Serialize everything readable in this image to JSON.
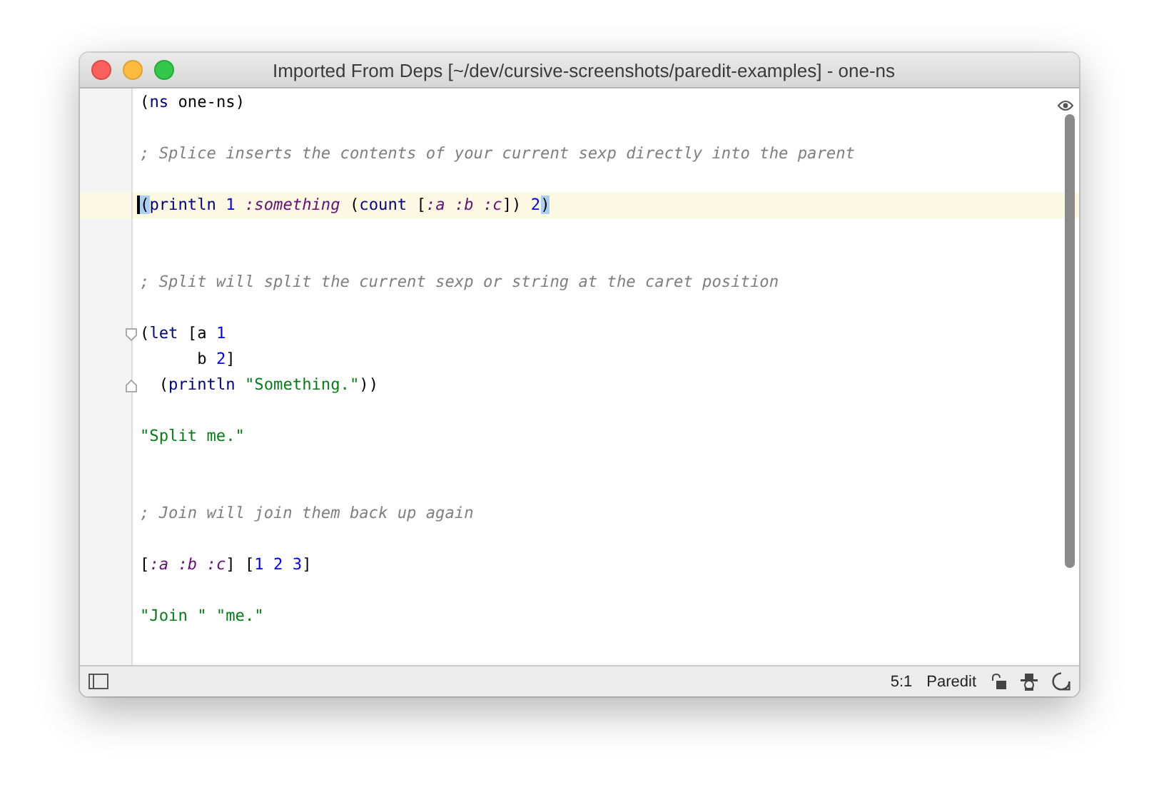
{
  "window": {
    "title": "Imported From Deps [~/dev/cursive-screenshots/paredit-examples] - one-ns"
  },
  "editor": {
    "lines": [
      {
        "kind": "code",
        "current": false,
        "tokens": [
          {
            "text": "(",
            "kind": "paren"
          },
          {
            "text": "ns",
            "kind": "form"
          },
          {
            "text": " one-ns",
            "kind": "symbol"
          },
          {
            "text": ")",
            "kind": "paren"
          }
        ]
      },
      {
        "kind": "blank"
      },
      {
        "kind": "code",
        "current": false,
        "tokens": [
          {
            "text": "; Splice inserts the contents of your current sexp directly into the parent",
            "kind": "comment"
          }
        ]
      },
      {
        "kind": "blank"
      },
      {
        "kind": "code",
        "current": true,
        "tokens": [
          {
            "text": "(",
            "kind": "paren",
            "matched": true
          },
          {
            "text": "println",
            "kind": "form"
          },
          {
            "text": " 1",
            "kind": "number"
          },
          {
            "text": " :something",
            "kind": "keyword"
          },
          {
            "text": " (",
            "kind": "paren"
          },
          {
            "text": "count",
            "kind": "form"
          },
          {
            "text": " [",
            "kind": "paren"
          },
          {
            "text": ":a :b :c",
            "kind": "keyword"
          },
          {
            "text": "]) ",
            "kind": "paren"
          },
          {
            "text": "2",
            "kind": "number"
          },
          {
            "text": ")",
            "kind": "paren",
            "matched": true
          }
        ]
      },
      {
        "kind": "blank"
      },
      {
        "kind": "blank"
      },
      {
        "kind": "code",
        "current": false,
        "tokens": [
          {
            "text": "; Split will split the current sexp or string at the caret position",
            "kind": "comment"
          }
        ]
      },
      {
        "kind": "blank"
      },
      {
        "kind": "code",
        "current": false,
        "fold_start": true,
        "tokens": [
          {
            "text": "(",
            "kind": "paren"
          },
          {
            "text": "let",
            "kind": "form"
          },
          {
            "text": " [a ",
            "kind": "symbol"
          },
          {
            "text": "1",
            "kind": "number"
          }
        ]
      },
      {
        "kind": "code",
        "current": false,
        "tokens": [
          {
            "text": "      b ",
            "kind": "symbol"
          },
          {
            "text": "2",
            "kind": "number"
          },
          {
            "text": "]",
            "kind": "paren"
          }
        ]
      },
      {
        "kind": "code",
        "current": false,
        "fold_end": true,
        "tokens": [
          {
            "text": "  (",
            "kind": "paren"
          },
          {
            "text": "println",
            "kind": "form"
          },
          {
            "text": " \"Something.\"",
            "kind": "string"
          },
          {
            "text": "))",
            "kind": "paren"
          }
        ]
      },
      {
        "kind": "blank"
      },
      {
        "kind": "code",
        "current": false,
        "tokens": [
          {
            "text": "\"Split me.\"",
            "kind": "string"
          }
        ]
      },
      {
        "kind": "blank"
      },
      {
        "kind": "blank"
      },
      {
        "kind": "code",
        "current": false,
        "tokens": [
          {
            "text": "; Join will join them back up again",
            "kind": "comment"
          }
        ]
      },
      {
        "kind": "blank"
      },
      {
        "kind": "code",
        "current": false,
        "tokens": [
          {
            "text": "[",
            "kind": "paren"
          },
          {
            "text": ":a :b :c",
            "kind": "keyword"
          },
          {
            "text": "] [",
            "kind": "paren"
          },
          {
            "text": "1 2 3",
            "kind": "number"
          },
          {
            "text": "]",
            "kind": "paren"
          }
        ]
      },
      {
        "kind": "blank"
      },
      {
        "kind": "code",
        "current": false,
        "tokens": [
          {
            "text": "\"Join \" \"me.\"",
            "kind": "string"
          }
        ]
      }
    ]
  },
  "status_bar": {
    "position": "5:1",
    "mode": "Paredit"
  }
}
